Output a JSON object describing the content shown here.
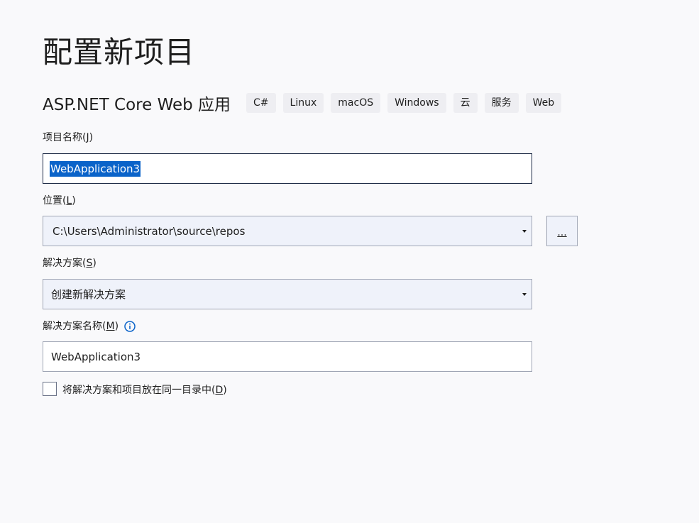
{
  "page": {
    "title": "配置新项目"
  },
  "template": {
    "name": "ASP.NET Core Web 应用",
    "tags": [
      "C#",
      "Linux",
      "macOS",
      "Windows",
      "云",
      "服务",
      "Web"
    ]
  },
  "project_name": {
    "label": "项目名称(",
    "access_key": "J",
    "label_end": ")",
    "value": "WebApplication3"
  },
  "location": {
    "label": "位置(",
    "access_key": "L",
    "label_end": ")",
    "value": "C:\\Users\\Administrator\\source\\repos",
    "browse_label": "..."
  },
  "solution": {
    "label": "解决方案(",
    "access_key": "S",
    "label_end": ")",
    "value": "创建新解决方案"
  },
  "solution_name": {
    "label": "解决方案名称(",
    "access_key": "M",
    "label_end": ")",
    "value": "WebApplication3"
  },
  "same_dir": {
    "label": "将解决方案和项目放在同一目录中(",
    "access_key": "D",
    "label_end": ")",
    "checked": false
  },
  "colors": {
    "selection": "#0a63c9",
    "info_icon": "#0a63c9"
  }
}
